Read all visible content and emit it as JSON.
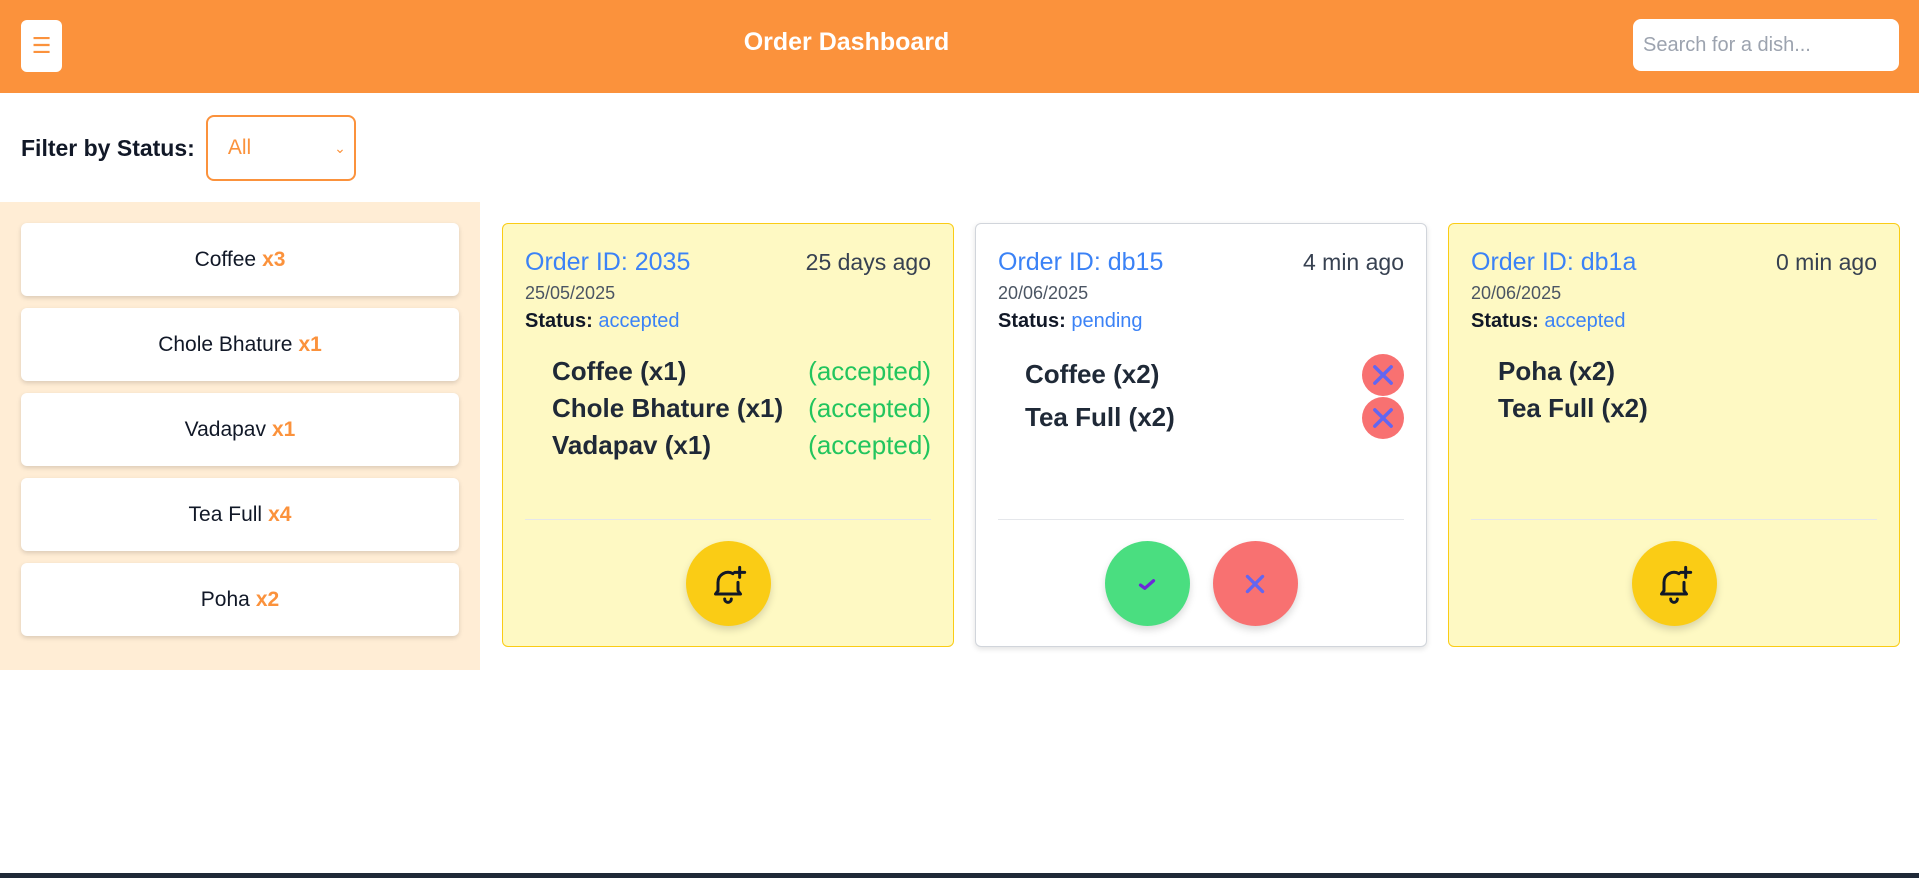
{
  "header": {
    "menu_icon": "☰",
    "title": "Order Dashboard",
    "search_placeholder": "Search for a dish..."
  },
  "filter": {
    "label": "Filter by Status:",
    "selected": "All"
  },
  "dishes": [
    {
      "name": "Coffee",
      "qty": "x3"
    },
    {
      "name": "Chole Bhature",
      "qty": "x1"
    },
    {
      "name": "Vadapav",
      "qty": "x1"
    },
    {
      "name": "Tea Full",
      "qty": "x4"
    },
    {
      "name": "Poha",
      "qty": "x2"
    }
  ],
  "orders": [
    {
      "id": "Order ID: 2035",
      "ago": "25 days ago",
      "date": "25/05/2025",
      "status_label": "Status:",
      "status": "accepted",
      "items": [
        {
          "name": "Coffee (x1)",
          "status": "(accepted)"
        },
        {
          "name": "Chole Bhature (x1)",
          "status": "(accepted)"
        },
        {
          "name": "Vadapav (x1)",
          "status": "(accepted)"
        }
      ]
    },
    {
      "id": "Order ID: db15",
      "ago": "4 min ago",
      "date": "20/06/2025",
      "status_label": "Status:",
      "status": "pending",
      "items": [
        {
          "name": "Coffee (x2)"
        },
        {
          "name": "Tea Full (x2)"
        }
      ]
    },
    {
      "id": "Order ID: db1a",
      "ago": "0 min ago",
      "date": "20/06/2025",
      "status_label": "Status:",
      "status": "accepted",
      "items": [
        {
          "name": "Poha (x2)"
        },
        {
          "name": "Tea Full (x2)"
        }
      ]
    }
  ],
  "colors": {
    "brand": "#fb923c",
    "accepted_bg": "#fef9c3",
    "link_blue": "#3b82f6",
    "accepted_green": "#22c55e",
    "reject_red": "#f87171"
  },
  "icons": {
    "bell": "bell-plus-icon",
    "accept": "check-icon",
    "reject": "close-icon"
  }
}
